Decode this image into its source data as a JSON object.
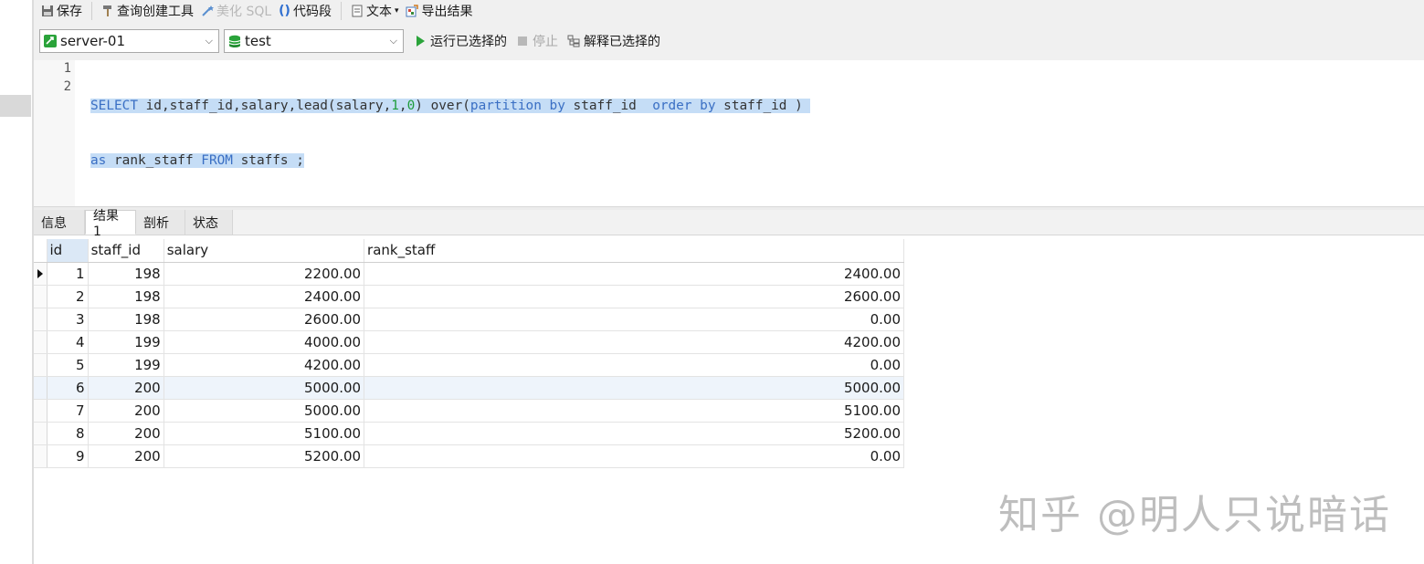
{
  "toolbar": {
    "save_label": "保存",
    "query_builder_label": "查询创建工具",
    "beautify_label": "美化 SQL",
    "snippet_label": "代码段",
    "text_label": "文本",
    "export_label": "导出结果",
    "connection_value": "server-01",
    "database_value": "test",
    "run_selected_label": "运行已选择的",
    "stop_label": "停止",
    "explain_selected_label": "解释已选择的"
  },
  "editor": {
    "line_numbers": [
      "1",
      "2"
    ],
    "line1": {
      "t1": "SELECT",
      "t2": " id,staff_id,salary,lead(salary,",
      "t3": "1",
      "t4": ",",
      "t5": "0",
      "t6": ") over(",
      "t7": "partition by",
      "t8": " staff_id  ",
      "t9": "order by",
      "t10": " staff_id )"
    },
    "line2": {
      "t1": "as",
      "t2": " rank_staff ",
      "t3": "FROM",
      "t4": " staffs ;"
    }
  },
  "tabs": [
    "信息",
    "结果 1",
    "剖析",
    "状态"
  ],
  "result": {
    "columns": [
      "id",
      "staff_id",
      "salary",
      "rank_staff"
    ],
    "rows": [
      [
        "1",
        "198",
        "2200.00",
        "2400.00"
      ],
      [
        "2",
        "198",
        "2400.00",
        "2600.00"
      ],
      [
        "3",
        "198",
        "2600.00",
        "0.00"
      ],
      [
        "4",
        "199",
        "4000.00",
        "4200.00"
      ],
      [
        "5",
        "199",
        "4200.00",
        "0.00"
      ],
      [
        "6",
        "200",
        "5000.00",
        "5000.00"
      ],
      [
        "7",
        "200",
        "5000.00",
        "5100.00"
      ],
      [
        "8",
        "200",
        "5100.00",
        "5200.00"
      ],
      [
        "9",
        "200",
        "5200.00",
        "0.00"
      ]
    ]
  },
  "watermark": "知乎 @明人只说暗话",
  "colors": {
    "toolbar_bg": "#f0f0f0",
    "selection": "#c5ddf6",
    "keyword": "#3a6fc4",
    "number": "#1e9c3a",
    "run_green": "#2aa33a"
  }
}
